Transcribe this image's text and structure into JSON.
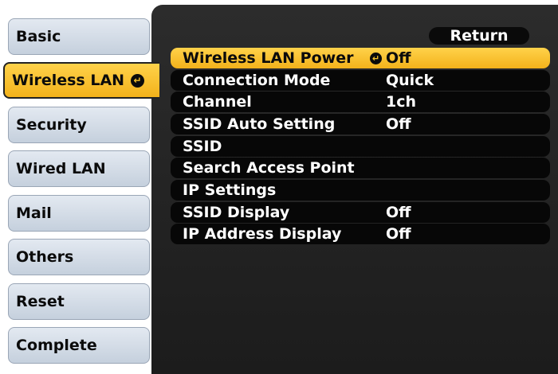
{
  "sidebar": {
    "tabs": [
      {
        "label": "Basic"
      },
      {
        "label": "Wireless LAN"
      },
      {
        "label": "Security"
      },
      {
        "label": "Wired LAN"
      },
      {
        "label": "Mail"
      },
      {
        "label": "Others"
      },
      {
        "label": "Reset"
      },
      {
        "label": "Complete"
      }
    ],
    "selected_tab": "Wireless LAN"
  },
  "panel": {
    "return_label": "Return",
    "items": [
      {
        "label": "Wireless LAN Power",
        "value": "Off"
      },
      {
        "label": "Connection Mode",
        "value": "Quick"
      },
      {
        "label": "Channel",
        "value": "1ch"
      },
      {
        "label": "SSID Auto Setting",
        "value": "Off"
      },
      {
        "label": "SSID",
        "value": ""
      },
      {
        "label": "Search Access Point",
        "value": ""
      },
      {
        "label": "IP Settings",
        "value": ""
      },
      {
        "label": "SSID Display",
        "value": "Off"
      },
      {
        "label": "IP Address Display",
        "value": "Off"
      }
    ],
    "selected_item": "Wireless LAN Power"
  },
  "icons": {
    "enter": "enter-arrow-icon"
  },
  "colors": {
    "highlight": "#f5c22a",
    "panel_bg": "#262626",
    "tab_bg": "#d3dbe5"
  }
}
